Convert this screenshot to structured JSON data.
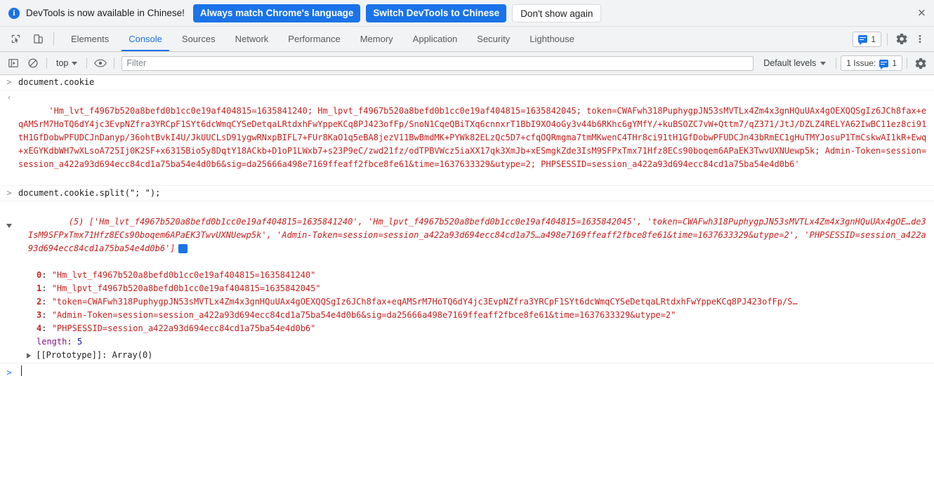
{
  "infobar": {
    "icon": "info-icon",
    "message": "DevTools is now available in Chinese!",
    "btn_always_match": "Always match Chrome's language",
    "btn_switch": "Switch DevTools to Chinese",
    "btn_dont_show": "Don't show again",
    "close": "×",
    "accent": "#1a73e8"
  },
  "tabbar": {
    "inspect_icon": "inspect-element-icon",
    "device_icon": "device-toolbar-icon",
    "tabs": [
      {
        "label": "Elements",
        "active": false
      },
      {
        "label": "Console",
        "active": true
      },
      {
        "label": "Sources",
        "active": false
      },
      {
        "label": "Network",
        "active": false
      },
      {
        "label": "Performance",
        "active": false
      },
      {
        "label": "Memory",
        "active": false
      },
      {
        "label": "Application",
        "active": false
      },
      {
        "label": "Security",
        "active": false
      },
      {
        "label": "Lighthouse",
        "active": false
      }
    ],
    "issues_count": "1",
    "settings_icon": "gear-icon",
    "more_icon": "more-vertical-icon"
  },
  "filterbar": {
    "clear_console_icon": "clear-console-icon",
    "no_entry_icon": "no-entry-icon",
    "context": "top",
    "eye_icon": "eye-icon",
    "filter_placeholder": "Filter",
    "filter_value": "",
    "levels": "Default levels",
    "issues_label": "1 Issue:",
    "issues_count": "1",
    "settings_icon": "gear-icon"
  },
  "console": {
    "entry1": {
      "prompt": ">",
      "command": "document.cookie",
      "return_arrow": "‹",
      "result_lines": [
        "'Hm_lvt_f4967b520a8befd0b1cc0e19af404815=1635841240; Hm_lpvt_f4967b520a8befd0b1cc0e19af404815=1635842045; token=CWAFwh318PuphygpJN53sMVTLx4Zm4x3gnHQuUAx4g",
        "OEXQQSgIz6JCh8fax+eqAMSrM7HoTQ6dY4jc3EvpNZfra3YRCpF1SYt6dcWmqCYSeDetqaLRtdxhFwYppeKCq8PJ423ofFp/SnoN1CqeQBiTXq6cnnxrT1BbI9XO4oGy3v44b6RKhc6gYMfY/+kuBSOZC7",
        "vW+Qttm7/qZ371/JtJ/DZLZ4RELYA62IwBC11ez8ci91tH1GfDobwPFUDCJnDanyp/36ohtBvkI4U/JkUUCLsD91ygwRNxpBIFL7+FUr8KaO1q5eBA8jezV11BwBmdMK+PYWk82ELzQc5D7+cfqOQRmgma",
        "7tmMKwenC4THr8ci91tH1GfDobwPFUDCJn43bRmEC1gHuTMYJosuP1TmCskwAI1kR+Ewq+xEGYKdbWH7wXLsoA725Ij0K2SF+x6315Bio5y8DqtY18ACkb+D1oP1LWxb7+s23P9eC/zwd21fz/odTPBVWc",
        "z5iaXX17qk3XmJb+xESmgkZde3IsM9SFPxTmx71Hfz8ECs90boqem6APaEK3TwvUXNUewp5k; Admin-Token=session=session_a422a93d694ecc84cd1a75ba54e4d0b6&sig=da25666a498e716",
        "9ffeaff2fbce8fe61&time=1637633329&utype=2; PHPSESSID=session_a422a93d694ecc84cd1a75ba54e4d0b6'"
      ]
    },
    "entry2": {
      "prompt": ">",
      "command": "document.cookie.split(\"; \");",
      "return_arrow": "‹",
      "summary_lines": [
        "(5) ['Hm_lvt_f4967b520a8befd0b1cc0e19af404815=1635841240', 'Hm_lpvt_f4967b520a8befd0b1cc0e19af404815=1635842045', 'token=CWAFwh318PuphygpJN53sMVTLx4Zm4x",
        "3gnHQuUAx4gOE…de3IsM9SFPxTmx71Hfz8ECs90boqem6APaEK3TwvUXNUewp5k', 'Admin-Token=session=session_a422a93d694ecc84cd1a75…a498e7169ffeaff2fbce8fe61&time=163",
        "7633329&utype=2', 'PHPSESSID=session_a422a93d694ecc84cd1a75ba54e4d0b6']"
      ],
      "properties": [
        {
          "key": "0",
          "value": "\"Hm_lvt_f4967b520a8befd0b1cc0e19af404815=1635841240\""
        },
        {
          "key": "1",
          "value": "\"Hm_lpvt_f4967b520a8befd0b1cc0e19af404815=1635842045\""
        },
        {
          "key": "2",
          "value": "\"token=CWAFwh318PuphygpJN53sMVTLx4Zm4x3gnHQuUAx4gOEXQQSgIz6JCh8fax+eqAMSrM7HoTQ6dY4jc3EvpNZfra3YRCpF1SYt6dcWmqCYSeDetqaLRtdxhFwYppeKCq8PJ423ofFp/S…"
        },
        {
          "key": "3",
          "value": "\"Admin-Token=session=session_a422a93d694ecc84cd1a75ba54e4d0b6&sig=da25666a498e7169ffeaff2fbce8fe61&time=1637633329&utype=2\""
        },
        {
          "key": "4",
          "value": "\"PHPSESSID=session_a422a93d694ecc84cd1a75ba54e4d0b6\""
        }
      ],
      "length_label": "length",
      "length_value": "5",
      "proto_label": "[[Prototype]]",
      "proto_value": "Array(0)",
      "info_badge": "i"
    },
    "prompt_row": {
      "prompt": ">"
    }
  }
}
